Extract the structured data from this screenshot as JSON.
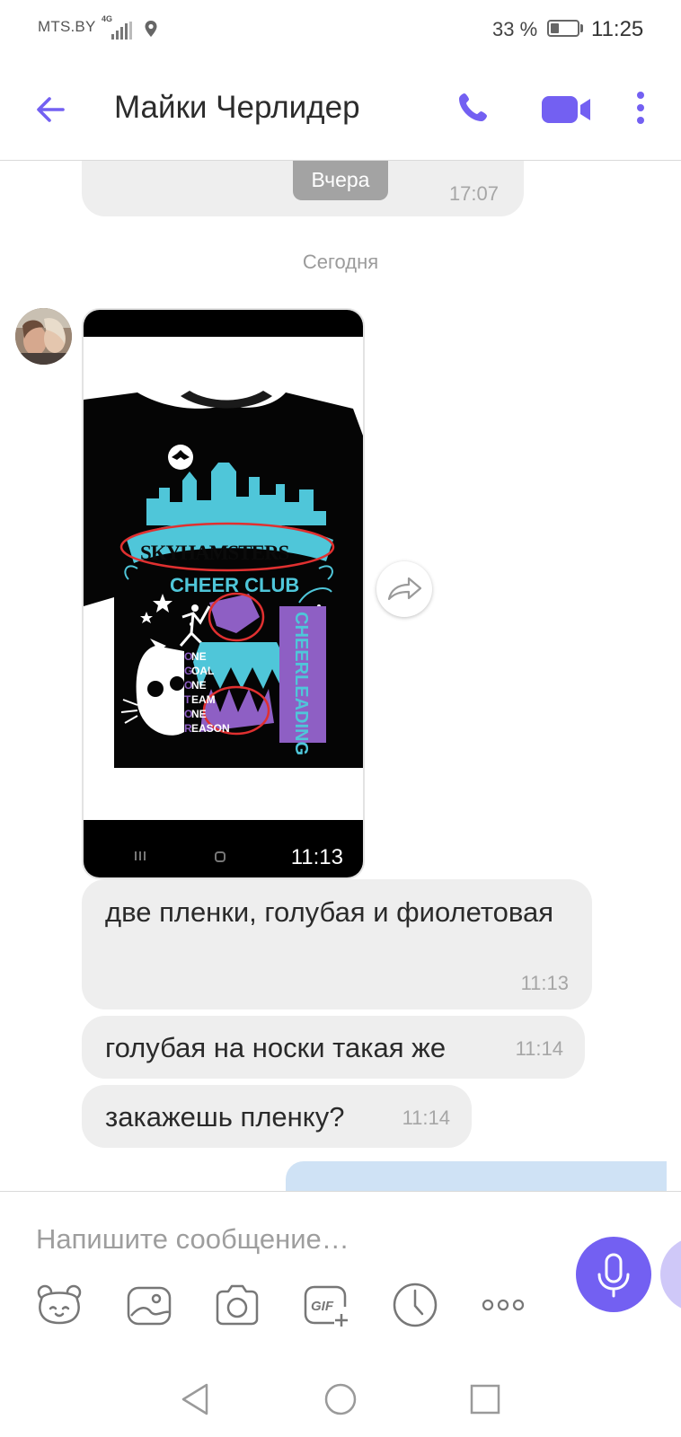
{
  "status_bar": {
    "carrier": "MTS.BY",
    "network": "4G",
    "battery": "33 %",
    "battery_level": 0.33,
    "time": "11:25",
    "icons": [
      "signal-icon",
      "location-icon",
      "battery-icon"
    ]
  },
  "header": {
    "title": "Майки Черлидер",
    "icons": [
      "back-arrow-icon",
      "phone-icon",
      "video-camera-icon",
      "more-vertical-icon"
    ],
    "accent_color": "#7360f2"
  },
  "chat": {
    "previous_message_time": "17:07",
    "yesterday_chip": "Вчера",
    "today_separator": "Сегодня",
    "photo_message": {
      "time": "11:13",
      "share_icon": "share-arrow-icon"
    },
    "messages": [
      {
        "text": "две пленки, голубая и фиолетовая",
        "time": "11:13"
      },
      {
        "text": "голубая на носки такая же",
        "time": "11:14"
      },
      {
        "text": "закажешь пленку?",
        "time": "11:14"
      }
    ],
    "incoming_bubble_color": "#eeeeee",
    "outgoing_bubble_color": "#cfe2f5"
  },
  "composer": {
    "placeholder": "Напишите сообщение…",
    "mic_icon": "microphone-icon",
    "tools": [
      "sticker-icon",
      "gallery-icon",
      "camera-icon",
      "gif-icon",
      "timer-icon",
      "more-horizontal-icon"
    ]
  },
  "nav_bar": {
    "icons": [
      "nav-back-icon",
      "nav-home-icon",
      "nav-recents-icon"
    ]
  }
}
